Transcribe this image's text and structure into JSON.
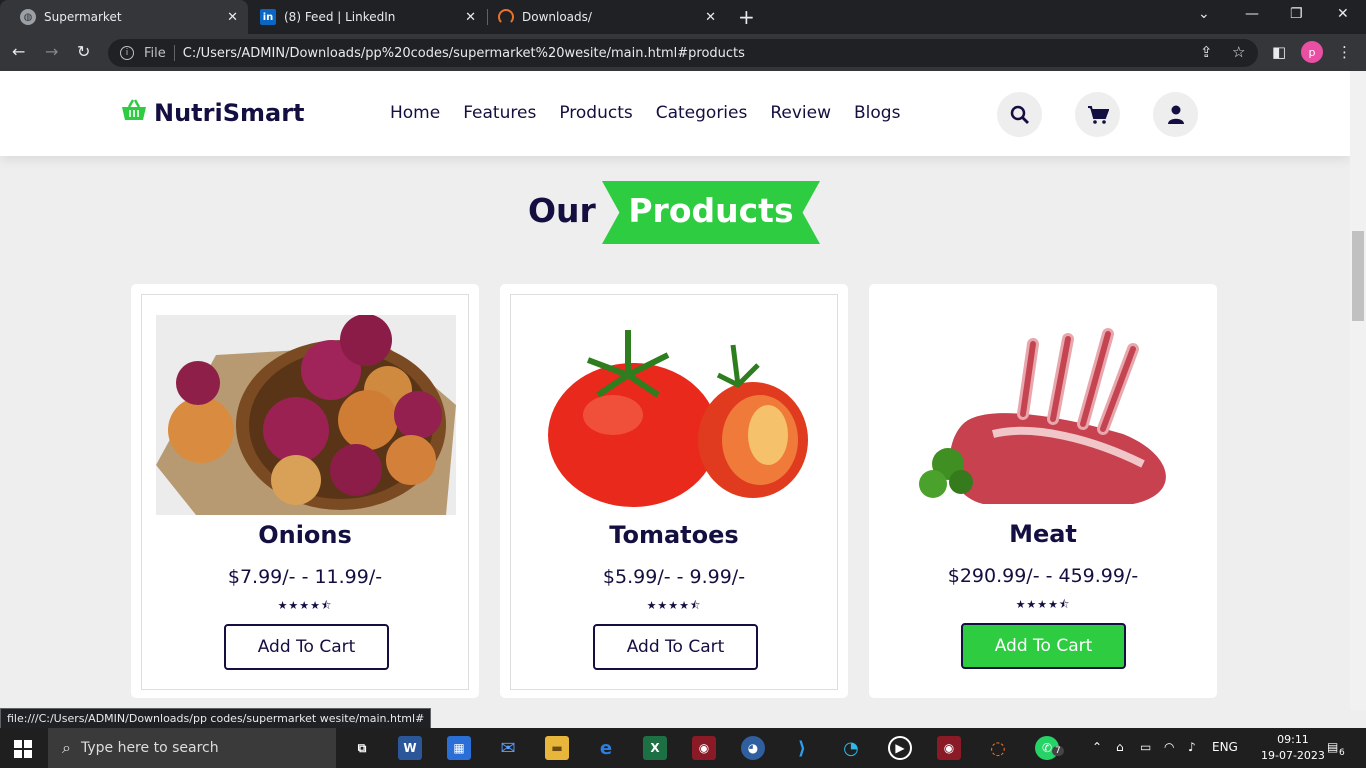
{
  "browser": {
    "tabs": [
      {
        "title": "Supermarket",
        "icon": "globe-icon",
        "active": true
      },
      {
        "title": "(8) Feed | LinkedIn",
        "icon": "linkedin-icon",
        "active": false
      },
      {
        "title": "Downloads/",
        "icon": "loading-icon",
        "active": false
      }
    ],
    "address": {
      "scheme_label": "File",
      "url": "C:/Users/ADMIN/Downloads/pp%20codes/supermarket%20wesite/main.html#products"
    },
    "profile_initial": "p",
    "status_url": "file:///C:/Users/ADMIN/Downloads/pp codes/supermarket wesite/main.html#"
  },
  "site": {
    "logo": "NutriSmart",
    "nav": [
      "Home",
      "Features",
      "Products",
      "Categories",
      "Review",
      "Blogs"
    ],
    "header_icons": [
      "search-icon",
      "cart-icon",
      "user-icon"
    ],
    "accent_color": "#2ecc40",
    "text_color": "#130f40"
  },
  "section": {
    "title_plain": "Our",
    "title_highlight": "Products"
  },
  "products": [
    {
      "name": "Onions",
      "price": "$7.99/- - 11.99/-",
      "stars": "★★★★⯪",
      "rating": 4.5,
      "button": "Add To Cart",
      "highlighted": false
    },
    {
      "name": "Tomatoes",
      "price": "$5.99/- - 9.99/-",
      "stars": "★★★★⯪",
      "rating": 4.5,
      "button": "Add To Cart",
      "highlighted": false
    },
    {
      "name": "Meat",
      "price": "$290.99/- - 459.99/-",
      "stars": "★★★★⯪",
      "rating": 4.5,
      "button": "Add To Cart",
      "highlighted": true
    }
  ],
  "taskbar": {
    "search_placeholder": "Type here to search",
    "language": "ENG",
    "time": "09:11",
    "date": "19-07-2023",
    "notifications": "6",
    "whatsapp_badge": "7"
  }
}
